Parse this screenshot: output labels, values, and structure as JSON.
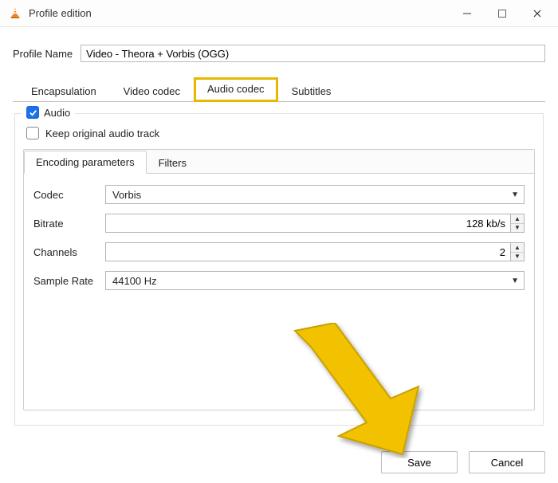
{
  "window": {
    "title": "Profile edition"
  },
  "profile": {
    "label": "Profile Name",
    "value": "Video - Theora + Vorbis (OGG)"
  },
  "tabs": {
    "encapsulation": "Encapsulation",
    "video": "Video codec",
    "audio": "Audio codec",
    "subtitles": "Subtitles"
  },
  "audio_group": {
    "title": "Audio",
    "keep_original": "Keep original audio track",
    "inner_tabs": {
      "encoding": "Encoding parameters",
      "filters": "Filters"
    },
    "fields": {
      "codec_label": "Codec",
      "codec_value": "Vorbis",
      "bitrate_label": "Bitrate",
      "bitrate_value": "128 kb/s",
      "channels_label": "Channels",
      "channels_value": "2",
      "samplerate_label": "Sample Rate",
      "samplerate_value": "44100 Hz"
    }
  },
  "buttons": {
    "save": "Save",
    "cancel": "Cancel"
  }
}
